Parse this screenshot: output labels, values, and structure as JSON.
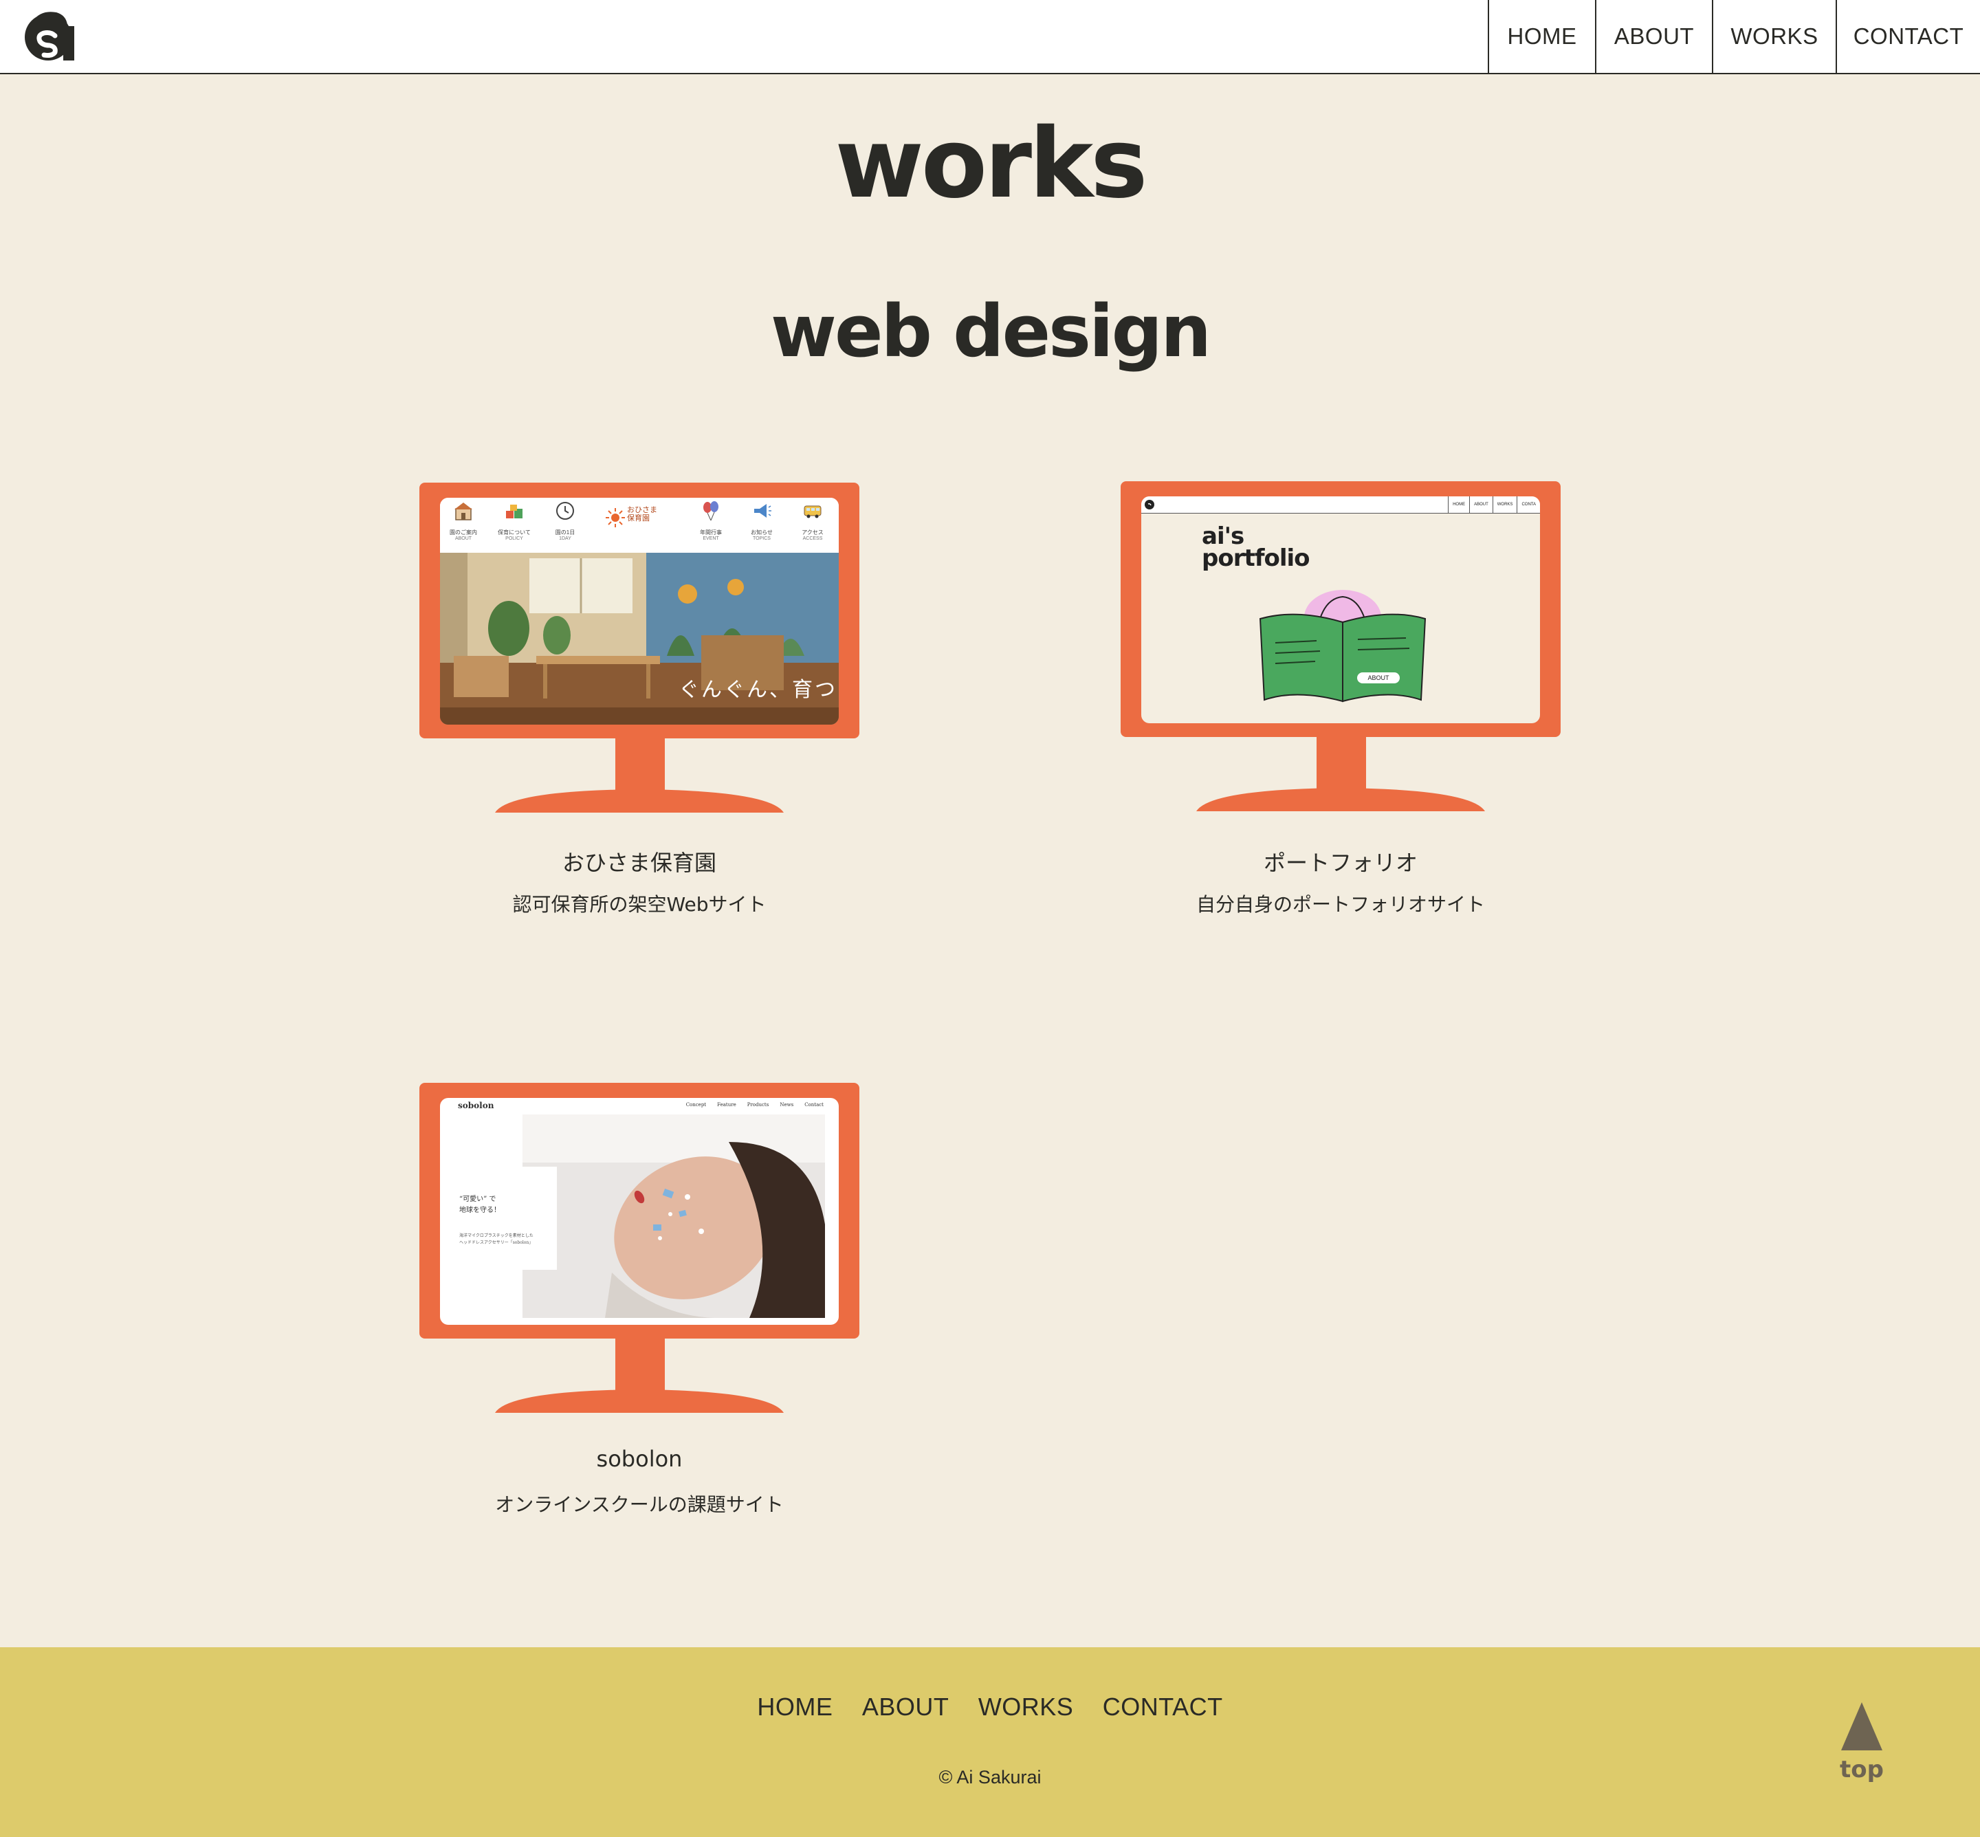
{
  "header": {
    "logo_alt": "as",
    "nav": [
      {
        "label": "HOME"
      },
      {
        "label": "ABOUT"
      },
      {
        "label": "WORKS"
      },
      {
        "label": "CONTACT"
      }
    ]
  },
  "page": {
    "title": "works",
    "section_title": "web design"
  },
  "works": [
    {
      "title": "おひさま保育園",
      "description": "認可保育所の架空Webサイト",
      "screen": {
        "brand": "おひさま\n保育園",
        "menu": [
          {
            "jp": "園のご案内",
            "en": "ABOUT",
            "icon": "house-icon"
          },
          {
            "jp": "保育について",
            "en": "POLICY",
            "icon": "blocks-icon"
          },
          {
            "jp": "園の1日",
            "en": "1DAY",
            "icon": "clock-icon"
          },
          {
            "jp": "年間行事",
            "en": "EVENT",
            "icon": "balloon-icon"
          },
          {
            "jp": "お知らせ",
            "en": "TOPICS",
            "icon": "megaphone-icon"
          },
          {
            "jp": "アクセス",
            "en": "ACCESS",
            "icon": "bus-icon"
          }
        ],
        "catch": "ぐんぐん、育つ"
      }
    },
    {
      "title": "ポートフォリオ",
      "description": "自分自身のポートフォリオサイト",
      "screen": {
        "nav": [
          "HOME",
          "ABOUT",
          "WORKS",
          "CONTA"
        ],
        "title_line1": "ai's",
        "title_line2": "portfolio",
        "about_label": "ABOUT"
      }
    },
    {
      "title": "sobolon",
      "description": "オンラインスクールの課題サイト",
      "screen": {
        "brand": "sobolon",
        "nav": [
          "Concept",
          "Feature",
          "Products",
          "News",
          "Contact"
        ],
        "copy_line1": "“可愛い” で",
        "copy_line2": "地球を守る！",
        "copy_small1": "海洋マイクロプラスチックを素材とした",
        "copy_small2": "ヘッドドレスアクセサリー「sobolon」"
      }
    }
  ],
  "footer": {
    "nav": [
      {
        "label": "HOME"
      },
      {
        "label": "ABOUT"
      },
      {
        "label": "WORKS"
      },
      {
        "label": "CONTACT"
      }
    ],
    "copyright": "© Ai Sakurai",
    "to_top_label": "top"
  },
  "colors": {
    "background": "#f3ede0",
    "text": "#2a2a26",
    "monitor": "#ec6c42",
    "footer": "#ddcb6b"
  }
}
